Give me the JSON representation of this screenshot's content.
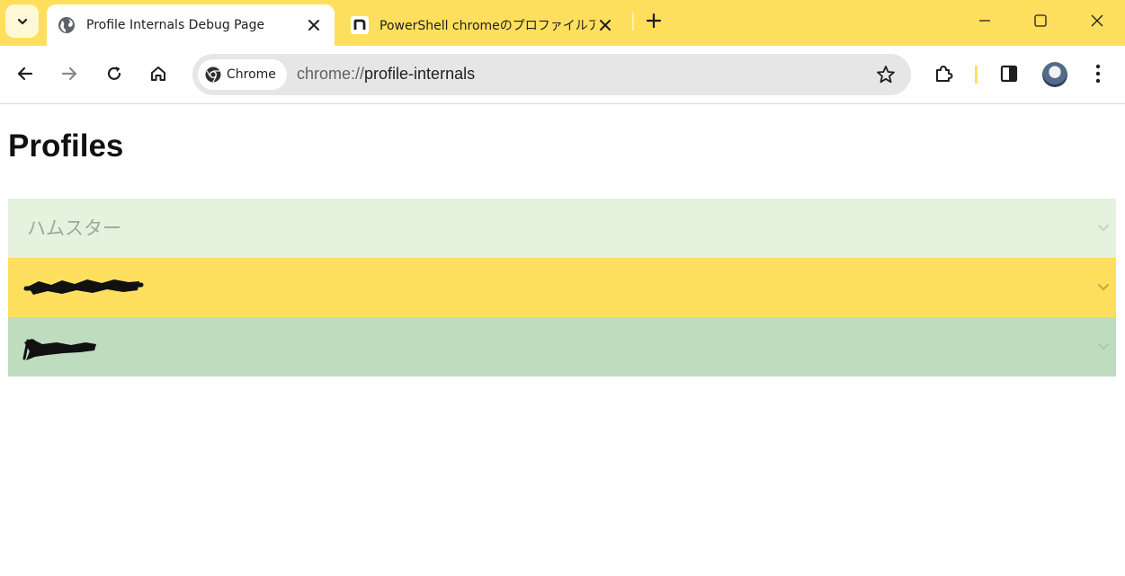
{
  "tabs": [
    {
      "title": "Profile Internals Debug Page",
      "active": true,
      "favicon": "globe-icon"
    },
    {
      "title": "PowerShell chromeのプロファイルアカ",
      "active": false,
      "favicon": "note-n-icon"
    }
  ],
  "omnibox": {
    "chip_label": "Chrome",
    "url_scheme": "chrome://",
    "url_rest": "profile-internals"
  },
  "page": {
    "title": "Profiles"
  },
  "profiles": [
    {
      "name": "ハムスター",
      "background": "#e4f2de",
      "redacted": false
    },
    {
      "name": "",
      "background": "#ffdf5d",
      "redacted": true
    },
    {
      "name": "",
      "background": "#bedcbe",
      "redacted": true
    }
  ],
  "colors": {
    "theme_yellow": "#ffdf5d",
    "profile_1": "#e4f2de",
    "profile_2": "#ffdf5d",
    "profile_3": "#bedcbe"
  }
}
